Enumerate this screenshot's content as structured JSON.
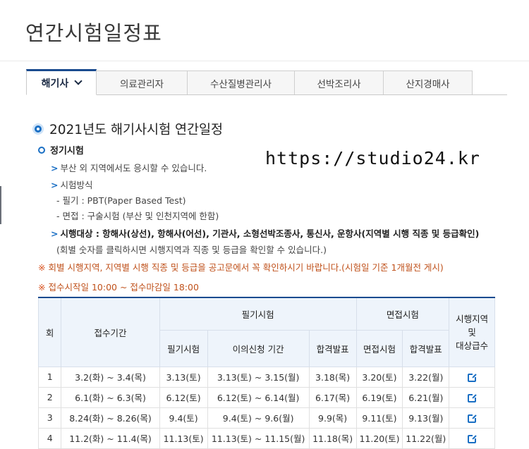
{
  "page": {
    "title": "연간시험일정표"
  },
  "tabs": [
    {
      "label": "해기사",
      "active": true
    },
    {
      "label": "의료관리자"
    },
    {
      "label": "수산질병관리사"
    },
    {
      "label": "선박조리사"
    },
    {
      "label": "산지경매사"
    }
  ],
  "section": {
    "title": "2021년도 해기사시험 연간일정",
    "sub_title": "정기시험",
    "lines": {
      "l1": "부산 외 지역에서도 응시할 수 있습니다.",
      "l2": "시험방식",
      "l3": "- 필기 : PBT(Paper Based Test)",
      "l4": "- 면접 : 구술시험 (부산 및 인천지역에 한함)",
      "l5": "시행대상 : 항해사(상선), 항해사(어선), 기관사, 소형선박조종사, 통신사, 운항사(지역별 시행 직종 및 등급확인)",
      "l6": "(회별 숫자를 클릭하시면 시행지역과 직종 및 등급을 확인할 수 있습니다.)"
    },
    "notice1": "회별 시행지역, 지역별 시행 직종 및 등급을 공고문에서 꼭 확인하시기 바랍니다.(시험일 기준 1개월전 게시)",
    "notice2": "접수시작일 10:00 ~ 접수마감일 18:00",
    "notice_mark": "※"
  },
  "watermark": "https://studio24.kr",
  "table": {
    "headers": {
      "round": "회",
      "period": "접수기간",
      "written": "필기시험",
      "interview": "면접시험",
      "region": "시행지역\n및\n대상급수",
      "written_date": "필기시험",
      "objection": "이의신청 기간",
      "written_result": "합격발표",
      "interview_date": "면접시험",
      "interview_result": "합격발표"
    },
    "rows": [
      {
        "round": "1",
        "period": "3.2(화) ~ 3.4(목)",
        "written_date": "3.13(토)",
        "objection": "3.13(토) ~ 3.15(월)",
        "written_result": "3.18(목)",
        "interview_date": "3.20(토)",
        "interview_result": "3.22(월)"
      },
      {
        "round": "2",
        "period": "6.1(화) ~ 6.3(목)",
        "written_date": "6.12(토)",
        "objection": "6.12(토) ~ 6.14(월)",
        "written_result": "6.17(목)",
        "interview_date": "6.19(토)",
        "interview_result": "6.21(월)"
      },
      {
        "round": "3",
        "period": "8.24(화) ~ 8.26(목)",
        "written_date": "9.4(토)",
        "objection": "9.4(토) ~ 9.6(월)",
        "written_result": "9.9(목)",
        "interview_date": "9.11(토)",
        "interview_result": "9.13(월)"
      },
      {
        "round": "4",
        "period": "11.2(화) ~ 11.4(목)",
        "written_date": "11.13(토)",
        "objection": "11.13(토) ~ 11.15(월)",
        "written_result": "11.18(목)",
        "interview_date": "11.20(토)",
        "interview_result": "11.22(월)"
      }
    ]
  },
  "colors": {
    "accent": "#1a6fc4",
    "navy": "#1a4b8f",
    "notice": "#c0521c"
  }
}
